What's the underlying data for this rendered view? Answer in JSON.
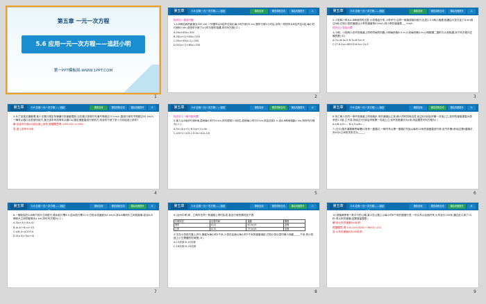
{
  "header": {
    "chapter": "第五章",
    "title": "5.6 应用一元一次方程——追赶小明",
    "tabs": [
      "课前自测",
      "课堂讲练互动",
      "课后巩固提升"
    ]
  },
  "slides": [
    {
      "number": "1",
      "type": "cover",
      "chapter": "第五章 一元一次方程",
      "title": "5.6 应用一元一次方程——追赶小明",
      "site": "第一PPT模板网-WWW.1PPT.COM"
    },
    {
      "number": "2",
      "page": "-1-",
      "active_tab": 0,
      "lines": [
        {
          "text": "知识点1  相向问题",
          "color": "pink"
        },
        {
          "text": "1.A,B两站间的距离为335 km,一列慢车从A站开往B站,每小时行驶55 km,慢车行驶1小时后,另有一列快车从B站开往A站,每小时行驶85 km.设快车行驶了x小时与慢车相遇,则可列方程(  D  )"
        },
        {
          "text": "A.55x+85x=335"
        },
        {
          "text": "B.55(x+1)+85x=335"
        },
        {
          "text": "C.55x+85(x-1)=335"
        },
        {
          "text": "D.55(x+1)+85x=335"
        }
      ]
    },
    {
      "number": "3",
      "page": "-2-",
      "active_tab": 0,
      "lines": [
        {
          "text": "2.小张和小李从A,B两地同时出发,小张骑自行车,小李步行,沿同一条路线相向而行.出发2.5 h两人相遇,相遇后小张又走了8 km到达A地.已知小张的速度比小李的速度快4 km/h,则小李的速度是___ km/h."
        },
        {
          "text": "知识点2  追及问题",
          "color": "pink"
        },
        {
          "text": "3.小明、小亮两人在环形跑道上同时同地同向跑,小明每秒跑6.5 m,小亮每秒跑5 m,小明跑第二圈时与小亮相遇,则下列方程中正确的是(  B  )"
        },
        {
          "text": "A.7x=6.5x-5     B.7x-6.5x=5"
        },
        {
          "text": "C.(7-6.5)x=400   D.6.5x=7x-5"
        }
      ]
    },
    {
      "number": "4",
      "page": "-3-",
      "active_tab": 0,
      "lines": [
        {
          "text": "4.为了加强交通管理,某十字路口规定车辆通行的速度限制,当在路口拐弯时车速不得超过15 km/h,直线行驶时不得超过45 km/h.一辆车从路口出发驶向前方,某日该车司机驾车从路口以规定速度直线行驶前方,则该车行驶了多少分钟后追上前车?"
        },
        {
          "text": "解:设该车行驶x分钟后追上前车,根据题意得: x/60×45=x+900",
          "color": "red"
        },
        {
          "text": "答:追上前车900米.",
          "color": "red"
        }
      ]
    },
    {
      "number": "5",
      "page": "-4-",
      "active_tab": 1,
      "lines": [
        {
          "text": "知识点3  一般行程问题",
          "color": "pink"
        },
        {
          "text": "5.某人从A地步行到B地,若他每小时行4 km,则可提前2 h到达;若他每小时行3 km,则会迟到1 h.设A,B两地相距x km,则所列方程为(  C  )"
        },
        {
          "text": "A.5x=4(x+1)      B.5(x+1)=4x"
        },
        {
          "text": "C.x/4+2=x/3-1   D.5x=4(x-10)"
        }
      ]
    },
    {
      "number": "6",
      "page": "-5-",
      "active_tab": 1,
      "lines": [
        {
          "text": "6.甲乙两人在同一条环形跑道上同向跑步,甲的速度比乙快,两人同时同地出发,经过8分钟后甲第一次追上乙;若甲的速度提高为原来的1.5倍,乙不变,则经过3分钟后甲就第一次追上乙.设环形跑道长为x米,则由题意可列方程为(  )"
        },
        {
          "text": "A.x/8-x/3=...   B.x/3-x/8=..."
        },
        {
          "text": "7.(长沙)某市道路两旁每隔50米有一盏路灯,一辆汽车从第一盏路灯开始以每秒10米的速度直线行驶,设汽车第n秒经过第k盏路灯,则n与k之间的关系式为_____."
        }
      ]
    },
    {
      "number": "7",
      "page": "-6-",
      "active_tab": 2,
      "lines": [
        {
          "text": "8.一艘轮船在A,B两个码头之间航行,顺水航行需8 h,逆水航行需10 h,已知水流速度为4 km/h,求A,B两码头之间的距离.若设A,B两码头之间的距离为x km,则可列方程为(  C  )"
        },
        {
          "text": "A.3(x+4)=5(x-4)"
        },
        {
          "text": "B.(x-4)÷8=x÷10"
        },
        {
          "text": "C.x/8-4=x/10+4"
        },
        {
          "text": "D.3(x-4)=5(x+4)"
        }
      ]
    },
    {
      "number": "8",
      "page": "-7-",
      "active_tab": 2,
      "lines": [
        {
          "text": "9.(台州中考)甲、乙两车在同一条道路上同时出发,各自行驶的情况如下表:"
        },
        {
          "text": "小王在小张前方路上步行,速度为每小时4千米,小张在后面以每小时5千米的速度追赶,已知小张出发时两人相距_____千米,则小张追上小王需要的时间是(  B  )"
        },
        {
          "text": "A.13分钟         B.15分钟"
        },
        {
          "text": "C.18分钟         D.20分钟"
        }
      ],
      "table": [
        [
          "行驶情况",
          "出发时间",
          "速度",
          "路程"
        ],
        [
          "甲车",
          "8:00",
          "60 km/h",
          "全程"
        ],
        [
          "乙车",
          "8:30",
          "75 km/h",
          "全程"
        ]
      ]
    },
    {
      "number": "9",
      "page": "-8-",
      "active_tab": 2,
      "lines": [
        {
          "text": "10.铁路两旁有一条平行的公路,某人在公路上以每小时6千米的速度行进,一列火车从后面开来,火车全长150米,通过此人用了10秒,求火车的速度(结果保留整数)."
        },
        {
          "text": "解:设火车的速度为x米/秒,",
          "color": "red"
        },
        {
          "text": "根据题意,得:10x-10×(6000÷3600)=150",
          "color": "red"
        },
        {
          "text": "答:火车的速度约为16米/秒.",
          "color": "red"
        }
      ]
    }
  ]
}
